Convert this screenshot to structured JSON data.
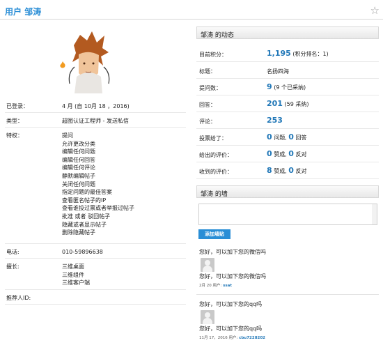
{
  "header": {
    "title": "用户 邹涛"
  },
  "profile": {
    "rows": [
      {
        "label": "已登录：",
        "value": [
          "4 月 (自 10月 18 ，2016)"
        ]
      },
      {
        "label": "类型：",
        "value": [
          "超图认证工程师 - 发送私信"
        ]
      },
      {
        "label": "特权：",
        "value": [
          "提问",
          "允许更改分类",
          "编辑任何问题",
          "编辑任何回答",
          "编辑任何评论",
          "静默编辑帖子",
          "关闭任何问题",
          "指定问题的最佳答案",
          "查看匿名帖子的IP",
          "查看谁投过票或者举报过帖子",
          "批准 或者 驳回帖子",
          "隐藏或者显示帖子",
          "删除隐藏帖子"
        ]
      },
      {
        "label": "电话:",
        "value": [
          "010-59896638"
        ]
      },
      {
        "label": "擅长:",
        "value": [
          "三维桌面",
          "三维组件",
          "三维客户端"
        ]
      },
      {
        "label": "推荐人ID:",
        "value": [
          ""
        ]
      }
    ]
  },
  "activity": {
    "heading": "邹涛 的动态",
    "stats": [
      {
        "label": "目前积分：",
        "num": "1,195",
        "suffix": "(积分排名：1)"
      },
      {
        "label": "标题：",
        "num": "",
        "suffix": "名扬四海"
      },
      {
        "label": "提问数：",
        "num": "9",
        "suffix": "(9 个已采纳)"
      },
      {
        "label": "回答：",
        "num": "201",
        "suffix": "(59 采纳)"
      },
      {
        "label": "评论：",
        "num": "253",
        "suffix": ""
      },
      {
        "label": "投票给了：",
        "num": "0",
        "suffix": "问题,",
        "num2": "0",
        "suffix2": "回答"
      },
      {
        "label": "给出的评价：",
        "num": "0",
        "suffix": "赞成,",
        "num2": "0",
        "suffix2": "反对"
      },
      {
        "label": "收到的评价：",
        "num": "8",
        "suffix": "赞成,",
        "num2": "0",
        "suffix2": "反对"
      }
    ]
  },
  "wall": {
    "heading": "邹涛 的墙",
    "add_button": "添加墙贴",
    "posts": [
      {
        "title": "您好，可以加下您的微信吗",
        "body": "您好，可以加下您的微信吗",
        "date": "2月 20 用户:",
        "user": "ssat"
      },
      {
        "title": "您好，可以加下您的qq吗",
        "body": "您好，可以加下您的qq吗",
        "date": "11月 17，2016 用户:",
        "user": "cbu7228202"
      }
    ]
  },
  "colors": {
    "accent": "#2a8ed6",
    "link": "#2278b8"
  }
}
